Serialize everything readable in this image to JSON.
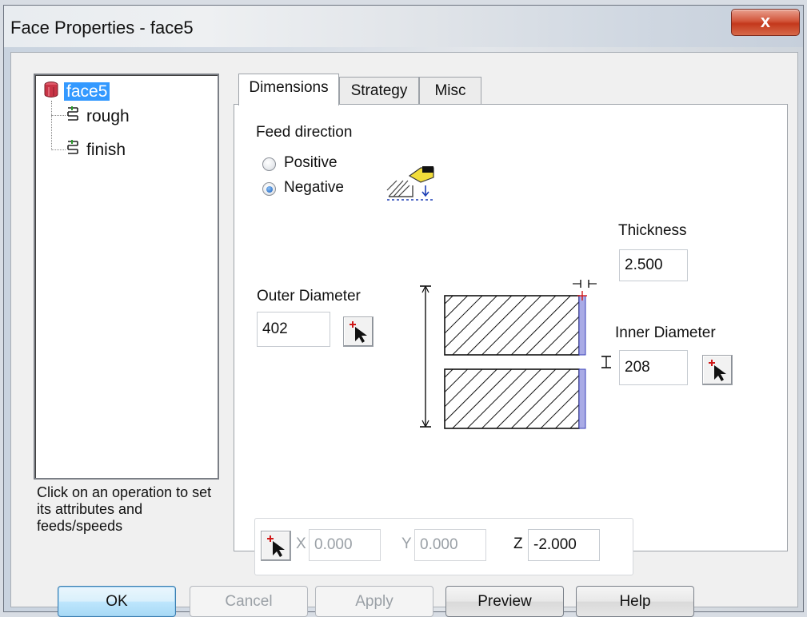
{
  "window": {
    "title": "Face Properties - face5",
    "close_label": "x"
  },
  "tree": {
    "root": "face5",
    "children": [
      "rough",
      "finish"
    ],
    "hint": "Click on an operation to set its attributes and feeds/speeds"
  },
  "tabs": [
    "Dimensions",
    "Strategy",
    "Misc"
  ],
  "dimensions": {
    "feed_direction_label": "Feed direction",
    "feed_options": [
      "Positive",
      "Negative"
    ],
    "feed_selected": "Negative",
    "thickness_label": "Thickness",
    "thickness_value": "2.500",
    "outer_diameter_label": "Outer Diameter",
    "outer_diameter_value": "402",
    "inner_diameter_label": "Inner Diameter",
    "inner_diameter_value": "208",
    "x_label": "X",
    "x_value": "0.000",
    "y_label": "Y",
    "y_value": "0.000",
    "z_label": "Z",
    "z_value": "-2.000"
  },
  "buttons": {
    "ok": "OK",
    "cancel": "Cancel",
    "apply": "Apply",
    "preview": "Preview",
    "help": "Help"
  },
  "icons": [
    "cylinder-icon",
    "operation-icon",
    "pick-point-icon",
    "face-feed-icon"
  ]
}
